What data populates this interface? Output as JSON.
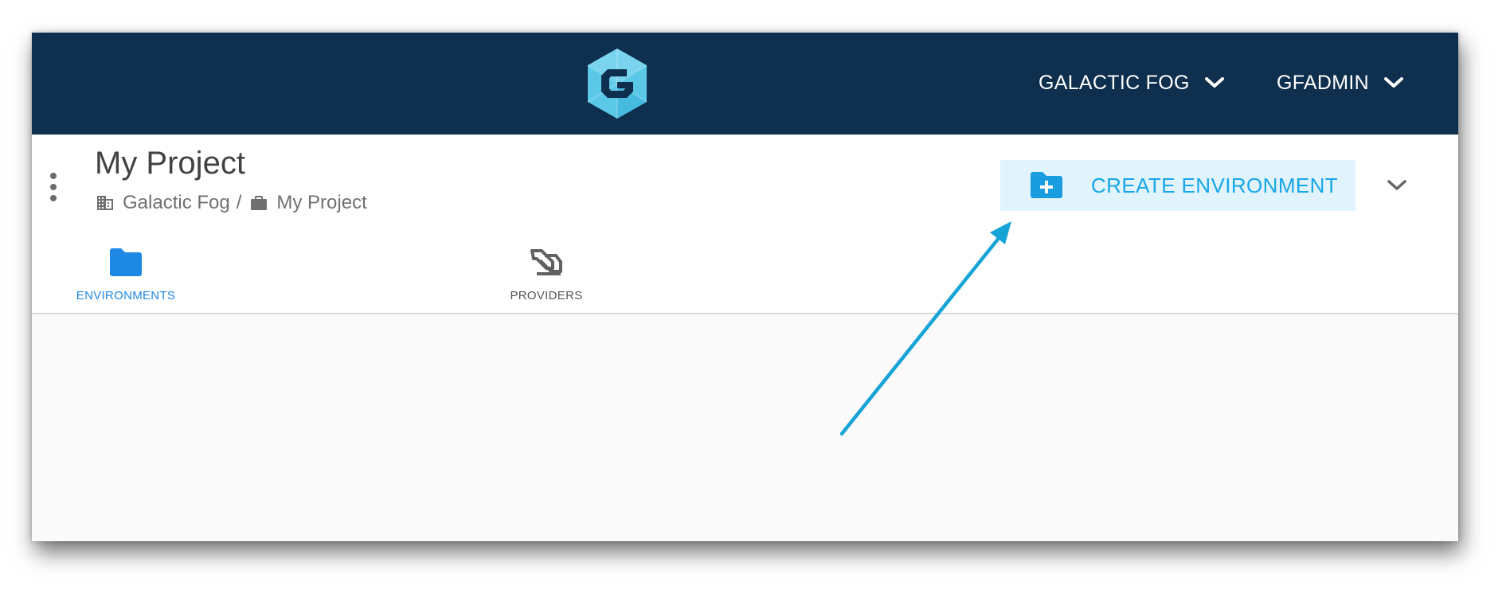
{
  "topbar": {
    "logo_name": "galactic-fog-logo",
    "org_menu": {
      "label": "GALACTIC FOG",
      "icon": "chevron-down-icon"
    },
    "user_menu": {
      "label": "GFADMIN",
      "icon": "chevron-down-icon"
    },
    "colors": {
      "background": "#0e2f4e",
      "logo": "#5cc8e8"
    }
  },
  "header": {
    "title": "My Project",
    "breadcrumb": {
      "org": {
        "label": "Galactic Fog",
        "icon": "building-icon"
      },
      "separator": "/",
      "project": {
        "label": "My Project",
        "icon": "briefcase-icon"
      }
    },
    "actions": {
      "create_environment": {
        "label": "CREATE ENVIRONMENT",
        "icon": "folder-plus-icon"
      },
      "expand_icon": "chevron-down-icon",
      "menu_icon": "more-vertical-icon"
    },
    "tabs": [
      {
        "label": "ENVIRONMENTS",
        "icon": "folder-icon",
        "active": true
      },
      {
        "label": "PROVIDERS",
        "icon": "providers-icon",
        "active": false
      }
    ]
  },
  "annotation": {
    "arrow_color": "#16a3d6"
  },
  "colors": {
    "accent": "#17a6e8",
    "button_bg": "#e1f4fd",
    "active_tab": "#1e88e5"
  }
}
